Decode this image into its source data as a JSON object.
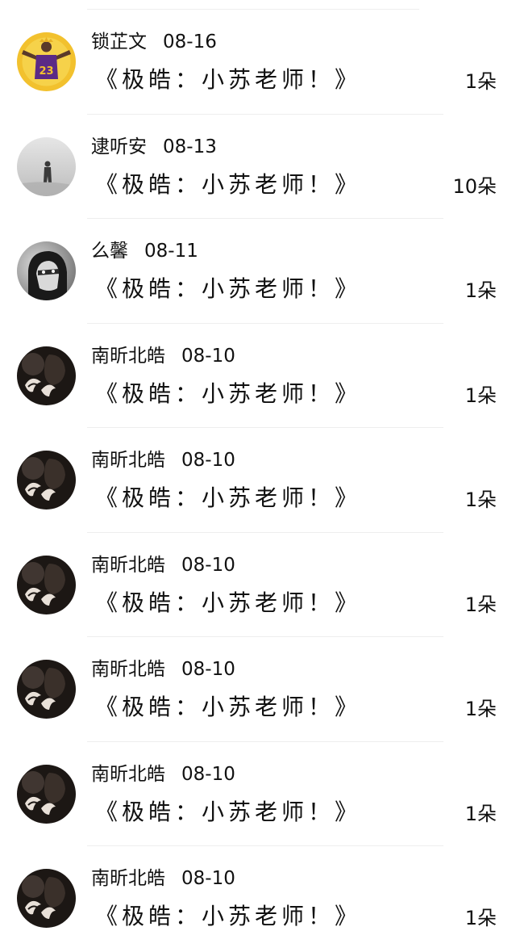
{
  "gift_list": {
    "items": [
      {
        "name": "锁芷文",
        "date": "08-16",
        "gift": "《极皓：小苏老师！》",
        "count": "1朵",
        "avatar_icon": "basketball-player-avatar"
      },
      {
        "name": "逮听安",
        "date": "08-13",
        "gift": "《极皓：小苏老师！》",
        "count": "10朵",
        "avatar_icon": "foggy-figure-avatar"
      },
      {
        "name": "么馨",
        "date": "08-11",
        "gift": "《极皓：小苏老师！》",
        "count": "1朵",
        "avatar_icon": "masked-hood-avatar"
      },
      {
        "name": "南昕北皓",
        "date": "08-10",
        "gift": "《极皓：小苏老师！》",
        "count": "1朵",
        "avatar_icon": "dark-portrait-avatar"
      },
      {
        "name": "南昕北皓",
        "date": "08-10",
        "gift": "《极皓：小苏老师！》",
        "count": "1朵",
        "avatar_icon": "dark-portrait-avatar"
      },
      {
        "name": "南昕北皓",
        "date": "08-10",
        "gift": "《极皓：小苏老师！》",
        "count": "1朵",
        "avatar_icon": "dark-portrait-avatar"
      },
      {
        "name": "南昕北皓",
        "date": "08-10",
        "gift": "《极皓：小苏老师！》",
        "count": "1朵",
        "avatar_icon": "dark-portrait-avatar"
      },
      {
        "name": "南昕北皓",
        "date": "08-10",
        "gift": "《极皓：小苏老师！》",
        "count": "1朵",
        "avatar_icon": "dark-portrait-avatar"
      },
      {
        "name": "南昕北皓",
        "date": "08-10",
        "gift": "《极皓：小苏老师！》",
        "count": "1朵",
        "avatar_icon": "dark-portrait-avatar"
      }
    ]
  },
  "colors": {
    "background": "#ffffff",
    "text": "#111111",
    "divider": "#eeeeee",
    "avatar_1_bg": "#f2c12e",
    "avatar_1_jersey": "#5b2a86"
  }
}
